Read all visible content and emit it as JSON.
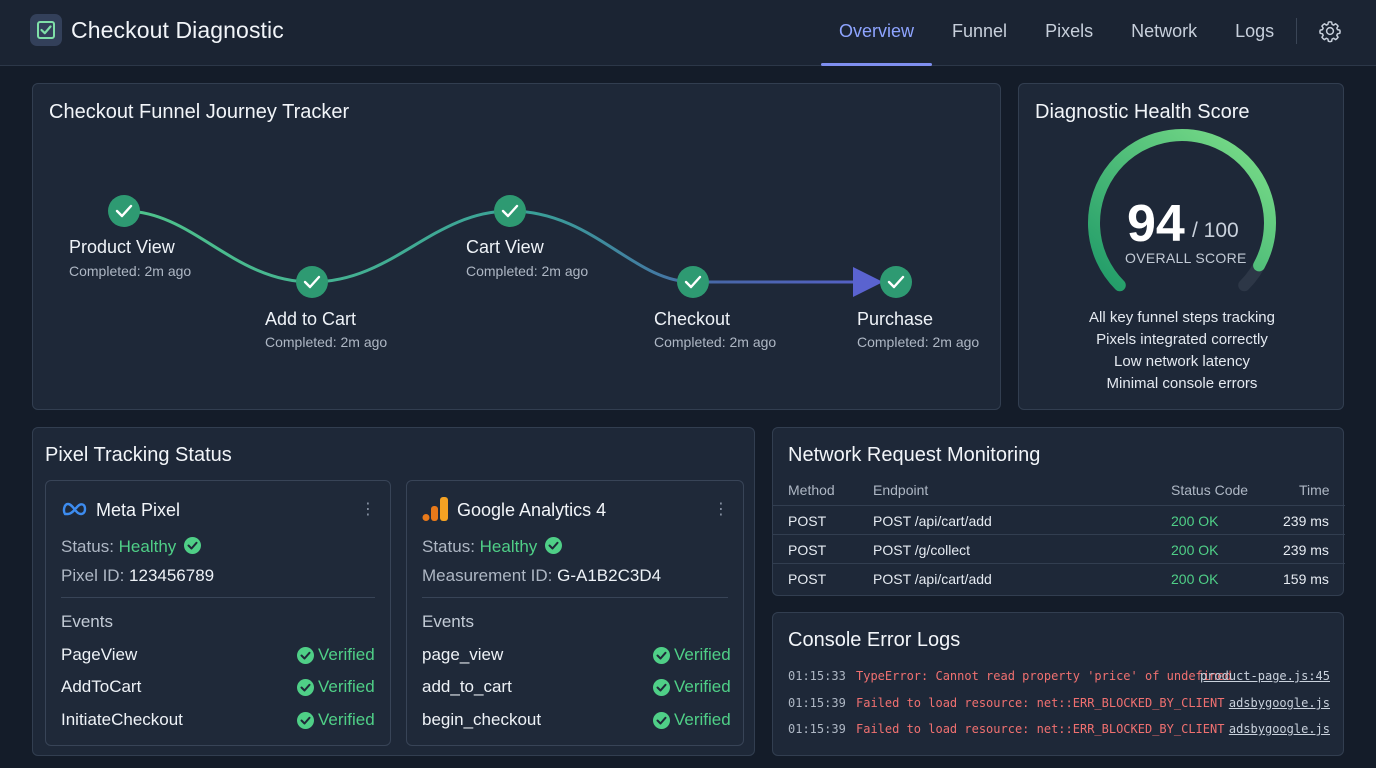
{
  "app": {
    "title": "Checkout Diagnostic"
  },
  "nav": {
    "tabs": [
      "Overview",
      "Funnel",
      "Pixels",
      "Network",
      "Logs"
    ],
    "active": "Overview"
  },
  "funnel": {
    "title": "Checkout Funnel Journey Tracker",
    "steps": [
      {
        "label": "Product View",
        "status": "Completed: 2m ago"
      },
      {
        "label": "Add to Cart",
        "status": "Completed: 2m ago"
      },
      {
        "label": "Cart View",
        "status": "Completed: 2m ago"
      },
      {
        "label": "Checkout",
        "status": "Completed: 2m ago"
      },
      {
        "label": "Purchase",
        "status": "Completed: 2m ago"
      }
    ]
  },
  "health": {
    "title": "Diagnostic Health Score",
    "score": "94",
    "max": "/ 100",
    "caption": "OVERALL SCORE",
    "fraction": 0.94,
    "items": [
      "All key funnel steps tracking",
      "Pixels integrated correctly",
      "Low network latency",
      "Minimal console errors"
    ]
  },
  "pixels": {
    "title": "Pixel Tracking Status",
    "cards": [
      {
        "name": "Meta Pixel",
        "status_label": "Status:",
        "status_value": "Healthy",
        "id_label": "Pixel ID:",
        "id_value": "123456789",
        "events_label": "Events",
        "events": [
          {
            "name": "PageView",
            "state": "Verified"
          },
          {
            "name": "AddToCart",
            "state": "Verified"
          },
          {
            "name": "InitiateCheckout",
            "state": "Verified"
          }
        ]
      },
      {
        "name": "Google Analytics 4",
        "status_label": "Status:",
        "status_value": "Healthy",
        "id_label": "Measurement ID:",
        "id_value": "G-A1B2C3D4",
        "events_label": "Events",
        "events": [
          {
            "name": "page_view",
            "state": "Verified"
          },
          {
            "name": "add_to_cart",
            "state": "Verified"
          },
          {
            "name": "begin_checkout",
            "state": "Verified"
          }
        ]
      }
    ]
  },
  "network": {
    "title": "Network Request Monitoring",
    "columns": [
      "Method",
      "Endpoint",
      "Status Code",
      "Time"
    ],
    "rows": [
      {
        "method": "POST",
        "endpoint": "POST /api/cart/add",
        "status": "200 OK",
        "time": "239 ms"
      },
      {
        "method": "POST",
        "endpoint": "POST /g/collect",
        "status": "200 OK",
        "time": "239 ms"
      },
      {
        "method": "POST",
        "endpoint": "POST /api/cart/add",
        "status": "200 OK",
        "time": "159 ms"
      }
    ]
  },
  "console": {
    "title": "Console Error Logs",
    "rows": [
      {
        "time": "01:15:33",
        "message": "TypeError: Cannot read property 'price' of undefined",
        "file": "product-page.js:45"
      },
      {
        "time": "01:15:39",
        "message": "Failed to load resource: net::ERR_BLOCKED_BY_CLIENT",
        "file": "adsbygoogle.js"
      },
      {
        "time": "01:15:39",
        "message": "Failed to load resource: net::ERR_BLOCKED_BY_CLIENT",
        "file": "adsbygoogle.js"
      }
    ]
  },
  "colors": {
    "accent": "#7f8ff0",
    "success": "#4fcf87",
    "error": "#f07070",
    "step_fill": "#2e9a72"
  },
  "icons": {
    "brand": "checkbox-icon",
    "settings": "gear-icon",
    "step": "check-circle-icon",
    "meta": "meta-infinity-icon",
    "ga4": "analytics-bars-icon",
    "menu": "kebab-menu-icon"
  }
}
